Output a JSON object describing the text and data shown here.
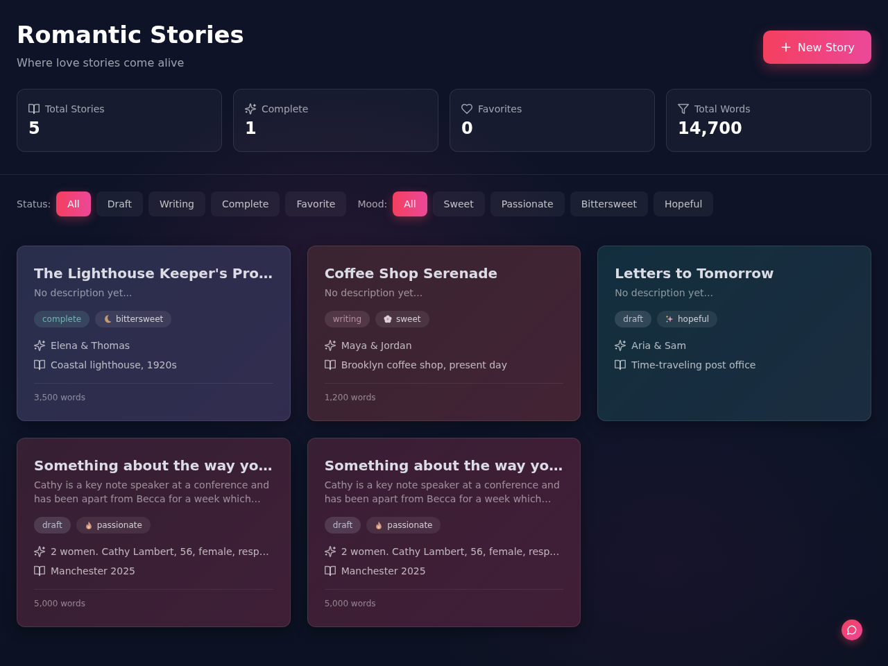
{
  "header": {
    "title": "Romantic Stories",
    "subtitle": "Where love stories come alive",
    "new_button": {
      "label": "New Story"
    }
  },
  "stats": [
    {
      "kind": "book",
      "label": "Total Stories",
      "value": "5"
    },
    {
      "kind": "sparkles",
      "label": "Complete",
      "value": "1"
    },
    {
      "kind": "heart",
      "label": "Favorites",
      "value": "0"
    },
    {
      "kind": "filter",
      "label": "Total Words",
      "value": "14,700"
    }
  ],
  "filters": [
    {
      "label": "Status:",
      "options": [
        {
          "label": "All",
          "selected": true
        },
        {
          "label": "Draft",
          "selected": false
        },
        {
          "label": "Writing",
          "selected": false
        },
        {
          "label": "Complete",
          "selected": false
        },
        {
          "label": "Favorite",
          "selected": false
        }
      ]
    },
    {
      "label": "Mood:",
      "options": [
        {
          "label": "All",
          "selected": true
        },
        {
          "label": "Sweet",
          "selected": false
        },
        {
          "label": "Passionate",
          "selected": false
        },
        {
          "label": "Bittersweet",
          "selected": false
        },
        {
          "label": "Hopeful",
          "selected": false
        }
      ]
    }
  ],
  "stories": [
    {
      "title": "The Lighthouse Keeper's Pro…",
      "description": "No description yet...",
      "color": "#262b4a",
      "status": {
        "label": "complete",
        "color": "#6fb3b0"
      },
      "mood": {
        "kind": "bittersweet",
        "label": "bittersweet"
      },
      "characters": "Elena & Thomas",
      "setting": "Coastal lighthouse, 1920s",
      "words": "3,500 words"
    },
    {
      "title": "Coffee Shop Serenade",
      "description": "No description yet...",
      "color": "#37212e",
      "status": {
        "label": "writing",
        "color": "#b8909f"
      },
      "mood": {
        "kind": "sweet",
        "label": "sweet"
      },
      "characters": "Maya & Jordan",
      "setting": "Brooklyn coffee shop, present day",
      "words": "1,200 words"
    },
    {
      "title": "Letters to Tomorrow",
      "description": "No description yet...",
      "color": "#0e2b3a",
      "status": {
        "label": "draft",
        "color": "#b9bccb"
      },
      "mood": {
        "kind": "hopeful",
        "label": "hopeful"
      },
      "characters": "Aria & Sam",
      "setting": "Time-traveling post office"
    },
    {
      "title": "Something about the way yo…",
      "description": "Cathy is a key note speaker at a conference and has been apart from Becca for a week which…",
      "color": "#331c30",
      "status": {
        "label": "draft",
        "color": "#b9bccb"
      },
      "mood": {
        "kind": "passionate",
        "label": "passionate"
      },
      "characters": "2 women. Cathy Lambert, 56, female, resp…",
      "setting": "Manchester 2025",
      "words": "5,000 words"
    },
    {
      "title": "Something about the way yo…",
      "description": "Cathy is a key note speaker at a conference and has been apart from Becca for a week which…",
      "color": "#361b31",
      "status": {
        "label": "draft",
        "color": "#b9bccb"
      },
      "mood": {
        "kind": "passionate",
        "label": "passionate"
      },
      "characters": "2 women. Cathy Lambert, 56, female, resp…",
      "setting": "Manchester 2025",
      "words": "5,000 words"
    }
  ]
}
